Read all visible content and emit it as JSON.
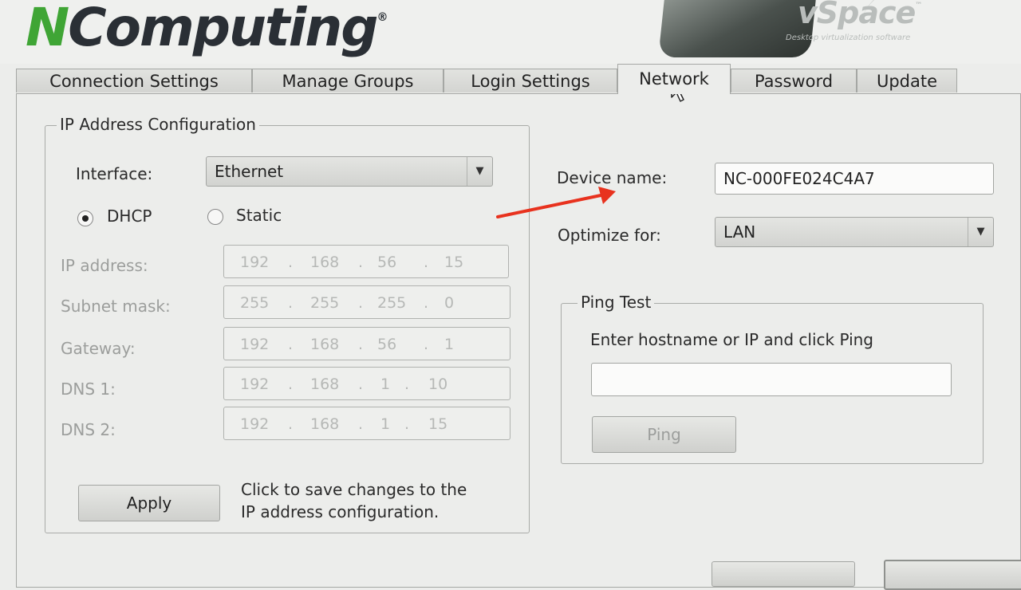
{
  "header": {
    "logo_n": "N",
    "logo_rest": "Computing",
    "logo_reg": "®",
    "product": "vSpace",
    "product_tm": "™",
    "tagline": "Desktop virtualization software"
  },
  "tabs": [
    {
      "label": "Connection Settings",
      "active": false
    },
    {
      "label": "Manage Groups",
      "active": false
    },
    {
      "label": "Login Settings",
      "active": false
    },
    {
      "label": "Network",
      "active": true
    },
    {
      "label": "Password",
      "active": false
    },
    {
      "label": "Update",
      "active": false
    }
  ],
  "ip_config": {
    "legend": "IP Address Configuration",
    "interface_label": "Interface:",
    "interface_value": "Ethernet",
    "dhcp_label": "DHCP",
    "static_label": "Static",
    "selected_mode": "DHCP",
    "fields": [
      {
        "label": "IP address:",
        "octets": [
          "192",
          "168",
          "56",
          "15"
        ]
      },
      {
        "label": "Subnet mask:",
        "octets": [
          "255",
          "255",
          "255",
          "0"
        ]
      },
      {
        "label": "Gateway:",
        "octets": [
          "192",
          "168",
          "56",
          "1"
        ]
      },
      {
        "label": "DNS 1:",
        "octets": [
          "192",
          "168",
          "1",
          "10"
        ]
      },
      {
        "label": "DNS 2:",
        "octets": [
          "192",
          "168",
          "1",
          "15"
        ]
      }
    ],
    "dot": ".",
    "apply_label": "Apply",
    "apply_help_line1": "Click to save changes to the",
    "apply_help_line2": "IP address configuration."
  },
  "device": {
    "name_label": "Device name:",
    "name_value": "NC-000FE024C4A7",
    "optimize_label": "Optimize for:",
    "optimize_value": "LAN"
  },
  "ping": {
    "legend": "Ping Test",
    "instruction": "Enter hostname or IP and click Ping",
    "input_value": "",
    "button_label": "Ping"
  },
  "colors": {
    "accent_green": "#3fa535",
    "annotation_red": "#e8321e"
  },
  "icons": {
    "dropdown": "triangle-down",
    "cursor": "mouse-pointer",
    "annotation": "red-arrow"
  }
}
